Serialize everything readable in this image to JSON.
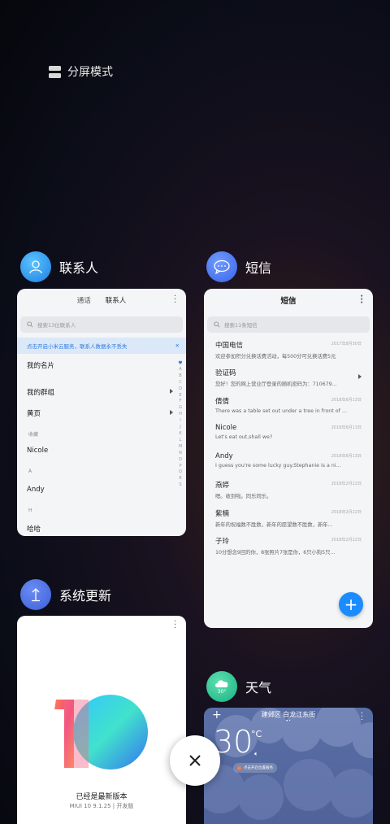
{
  "split_screen": {
    "label": "分屏模式",
    "icon": "split-screen-icon"
  },
  "close_label": "×",
  "contacts": {
    "app_name": "联系人",
    "tabs": [
      "通话",
      "联系人"
    ],
    "search_placeholder": "搜索13位联系人",
    "banner_text": "点击开启小米云服务，联系人数据永不丢失",
    "banner_close": "✕",
    "rows": {
      "my_card": "我的名片",
      "my_groups": "我的群组",
      "yellow_pages": "黄页",
      "favorites_header": "收藏",
      "nicole": "Nicole",
      "section_a": "A",
      "andy": "Andy",
      "section_h": "H",
      "haha": "哈哈"
    },
    "alphabet": [
      "A",
      "B",
      "C",
      "D",
      "E",
      "F",
      "G",
      "H",
      "I",
      "J",
      "K",
      "L",
      "M",
      "N",
      "O",
      "P",
      "Q",
      "R",
      "S"
    ]
  },
  "sms": {
    "app_name": "短信",
    "title": "短信",
    "search_placeholder": "搜索11条短信",
    "messages": [
      {
        "name": "中国电信",
        "date": "2017年8月30日",
        "body": "欢迎参加积分兑换话费活动，每500分可兑换话费5元"
      },
      {
        "name": "验证码",
        "date": "",
        "body": "您好！您的网上营业厅登录的随机密码为：710679..."
      },
      {
        "name": "倩倩",
        "date": "2018年6月13日",
        "body": "There was a table set out under a tree in front of ..."
      },
      {
        "name": "Nicole",
        "date": "2018年6月13日",
        "body": "Let's eat out,shall we?"
      },
      {
        "name": "Andy",
        "date": "2018年6月13日",
        "body": "I guess you're some lucky guy.Stephanie is a ni..."
      },
      {
        "name": "燕婷",
        "date": "2018年2月22日",
        "body": "嗯。收到啦。同乐同乐。"
      },
      {
        "name": "紫楠",
        "date": "2018年2月22日",
        "body": "新年的祝福数不胜数，新年的愿望数不胜数，新年..."
      },
      {
        "name": "子玲",
        "date": "2018年2月22日",
        "body": "10分想念9回的你，8张照片7张是你，6只小狗5只..."
      }
    ],
    "fab": "+"
  },
  "update": {
    "app_name": "系统更新",
    "status": "已经是最新版本",
    "version": "MIUI 10 9.1.25 | 开发版"
  },
  "weather": {
    "app_name": "天气",
    "icon_temp": "30°",
    "location": "建邺区 白龙江东街",
    "temperature": "30",
    "unit": "°C",
    "add": "+",
    "hint": "点击开启位置服务"
  }
}
